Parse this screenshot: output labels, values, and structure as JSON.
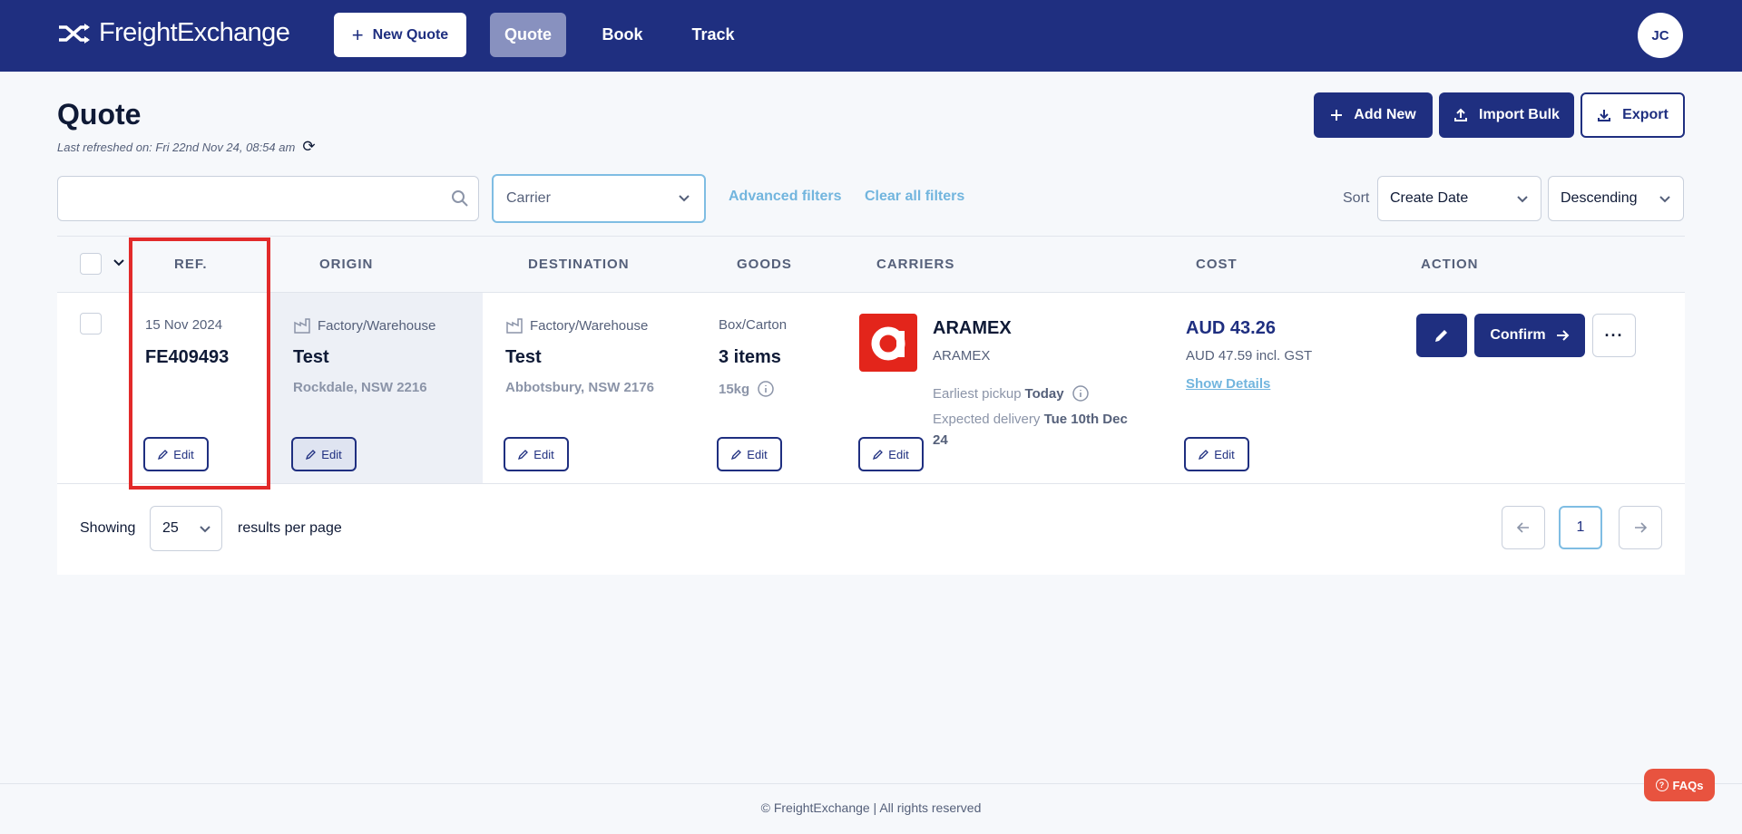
{
  "header": {
    "logo_text": "FreightExchange",
    "new_quote_label": "New Quote",
    "nav": [
      {
        "label": "Quote",
        "active": true
      },
      {
        "label": "Book",
        "active": false
      },
      {
        "label": "Track",
        "active": false
      }
    ],
    "avatar_initials": "JC"
  },
  "page": {
    "title": "Quote",
    "last_refreshed": "Last refreshed on: Fri 22nd Nov 24, 08:54 am",
    "actions": {
      "add_new": "Add New",
      "import_bulk": "Import Bulk",
      "export": "Export"
    }
  },
  "filters": {
    "search_value": "",
    "carrier_placeholder": "Carrier",
    "advanced_filters": "Advanced filters",
    "clear_all_filters": "Clear all filters",
    "sort_label": "Sort",
    "sort_field": "Create Date",
    "sort_order": "Descending"
  },
  "table": {
    "columns": [
      "REF.",
      "ORIGIN",
      "DESTINATION",
      "GOODS",
      "CARRIERS",
      "COST",
      "ACTION"
    ],
    "rows": [
      {
        "ref_date": "15 Nov 2024",
        "ref_id": "FE409493",
        "origin_type": "Factory/Warehouse",
        "origin_name": "Test",
        "origin_location": "Rockdale, NSW 2216",
        "dest_type": "Factory/Warehouse",
        "dest_name": "Test",
        "dest_location": "Abbotsbury, NSW 2176",
        "goods_type": "Box/Carton",
        "goods_count": "3 items",
        "goods_weight": "15kg",
        "carrier_name": "ARAMEX",
        "carrier_sub": "ARAMEX",
        "pickup_label": "Earliest pickup",
        "pickup_value": "Today",
        "delivery_label": "Expected delivery",
        "delivery_value": "Tue 10th Dec 24",
        "cost": "AUD 43.26",
        "cost_gst": "AUD 47.59 incl. GST",
        "show_details": "Show Details",
        "edit_label": "Edit",
        "confirm_label": "Confirm",
        "more_label": "···"
      }
    ]
  },
  "pagination": {
    "showing": "Showing",
    "per_page": "25",
    "results_per_page": "results per page",
    "current_page": "1"
  },
  "footer": {
    "copyright": "© FreightExchange | All rights reserved",
    "faqs": "FAQs"
  },
  "colors": {
    "brand": "#1f2f80",
    "accent_link": "#72b5de",
    "highlight": "#e22a2a",
    "carrier_logo": "#e3251b",
    "faq": "#e8533f"
  }
}
